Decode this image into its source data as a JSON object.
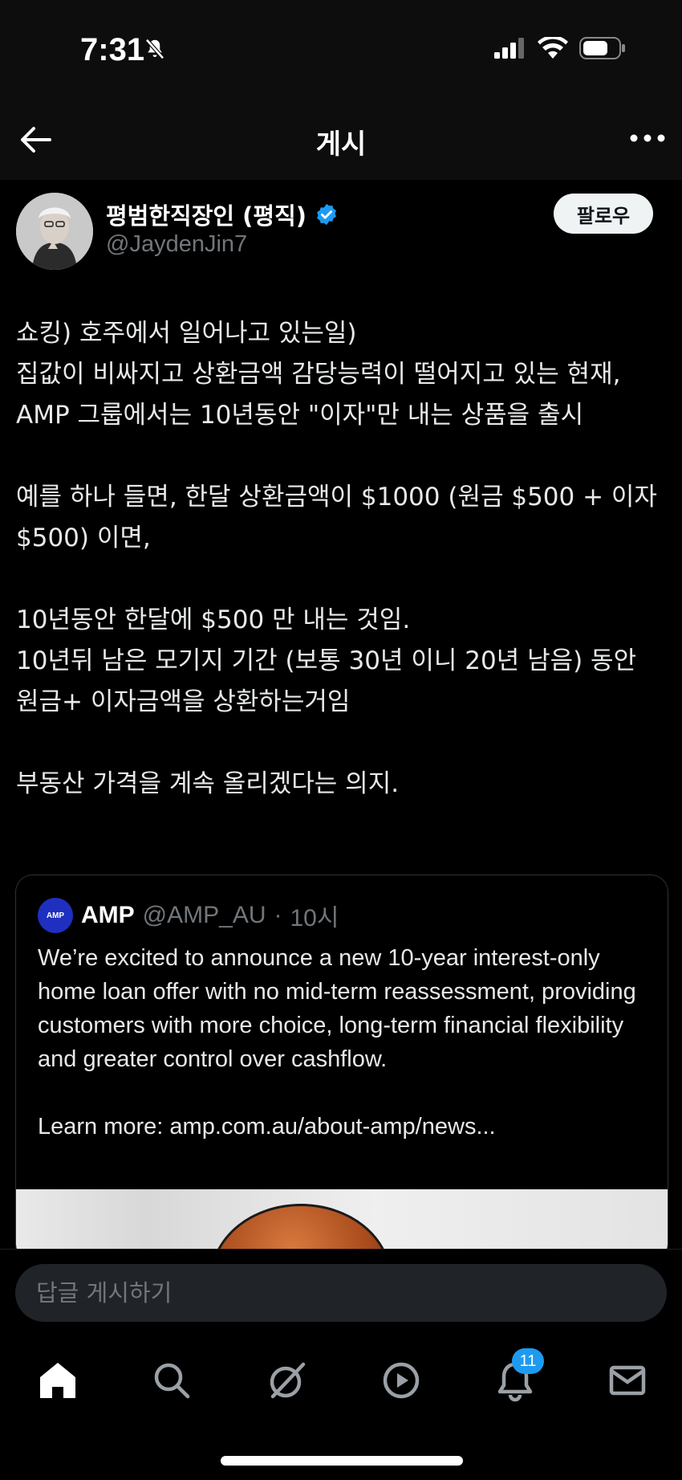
{
  "status_bar": {
    "time": "7:31"
  },
  "header": {
    "title": "게시"
  },
  "author": {
    "name": "평범한직장인 (평직)",
    "handle": "@JaydenJin7",
    "follow_label": "팔로우"
  },
  "post": {
    "lines": [
      "쇼킹) 호주에서 일어나고 있는일)",
      "집값이 비싸지고 상환금액 감당능력이 떨어지고 있는 현재,",
      "AMP 그룹에서는 10년동안 \"이자\"만 내는 상품을 출시",
      "",
      "예를 하나 들면, 한달 상환금액이 $1000 (원금 $500 + 이자 $500) 이면,",
      "",
      "10년동안 한달에 $500 만 내는 것임.",
      "10년뒤 남은 모기지 기간 (보통 30년 이니 20년 남음) 동안 원금+ 이자금액을 상환하는거임",
      "",
      "부동산 가격을 계속 올리겠다는 의지."
    ]
  },
  "quote": {
    "avatar_text": "AMP",
    "name": "AMP",
    "handle": "@AMP_AU",
    "time": "10시",
    "text_1": "We’re excited to announce a new 10-year interest-only home loan offer with no mid-term reassessment, providing customers with more choice, long-term financial flexibility and greater control over cashflow.",
    "text_2": "Learn more: amp.com.au/about-amp/news..."
  },
  "reply": {
    "placeholder": "답글 게시하기"
  },
  "nav": {
    "items": [
      "home-icon",
      "search-icon",
      "grok-icon",
      "video-icon",
      "bell-icon",
      "mail-icon"
    ],
    "notification_count": "11"
  },
  "colors": {
    "background": "#000000",
    "accent": "#1d9bf0",
    "muted": "#71767b"
  }
}
